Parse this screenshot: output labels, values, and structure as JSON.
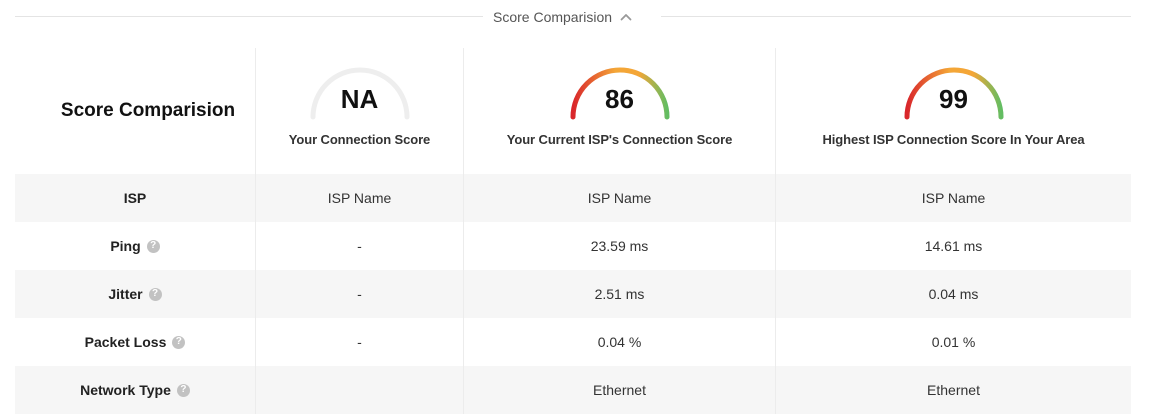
{
  "header": {
    "title": "Score Comparision",
    "toggle_icon": "chevron-up-icon"
  },
  "comparison": {
    "title": "Score Comparision",
    "columns": [
      {
        "score": "NA",
        "score_fraction": 0,
        "label": "Your Connection Score"
      },
      {
        "score": "86",
        "score_fraction": 0.86,
        "label": "Your Current ISP's Connection Score"
      },
      {
        "score": "99",
        "score_fraction": 0.99,
        "label": "Highest ISP Connection Score In Your Area"
      }
    ],
    "rows": [
      {
        "label": "ISP",
        "help": false,
        "values": [
          "ISP Name",
          "ISP Name",
          "ISP Name"
        ]
      },
      {
        "label": "Ping",
        "help": true,
        "values": [
          "-",
          "23.59 ms",
          "14.61 ms"
        ]
      },
      {
        "label": "Jitter",
        "help": true,
        "values": [
          "-",
          "2.51 ms",
          "0.04 ms"
        ]
      },
      {
        "label": "Packet Loss",
        "help": true,
        "values": [
          "-",
          "0.04 %",
          "0.01 %"
        ]
      },
      {
        "label": "Network Type",
        "help": true,
        "values": [
          "",
          "Ethernet",
          "Ethernet"
        ]
      }
    ]
  },
  "colors": {
    "gauge_empty": "#eeeeee",
    "gauge_red": "#d9262b",
    "gauge_orange": "#f4a637",
    "gauge_green": "#63bd62",
    "row_shade": "#f6f6f6",
    "help_icon": "#c2c2c2"
  }
}
